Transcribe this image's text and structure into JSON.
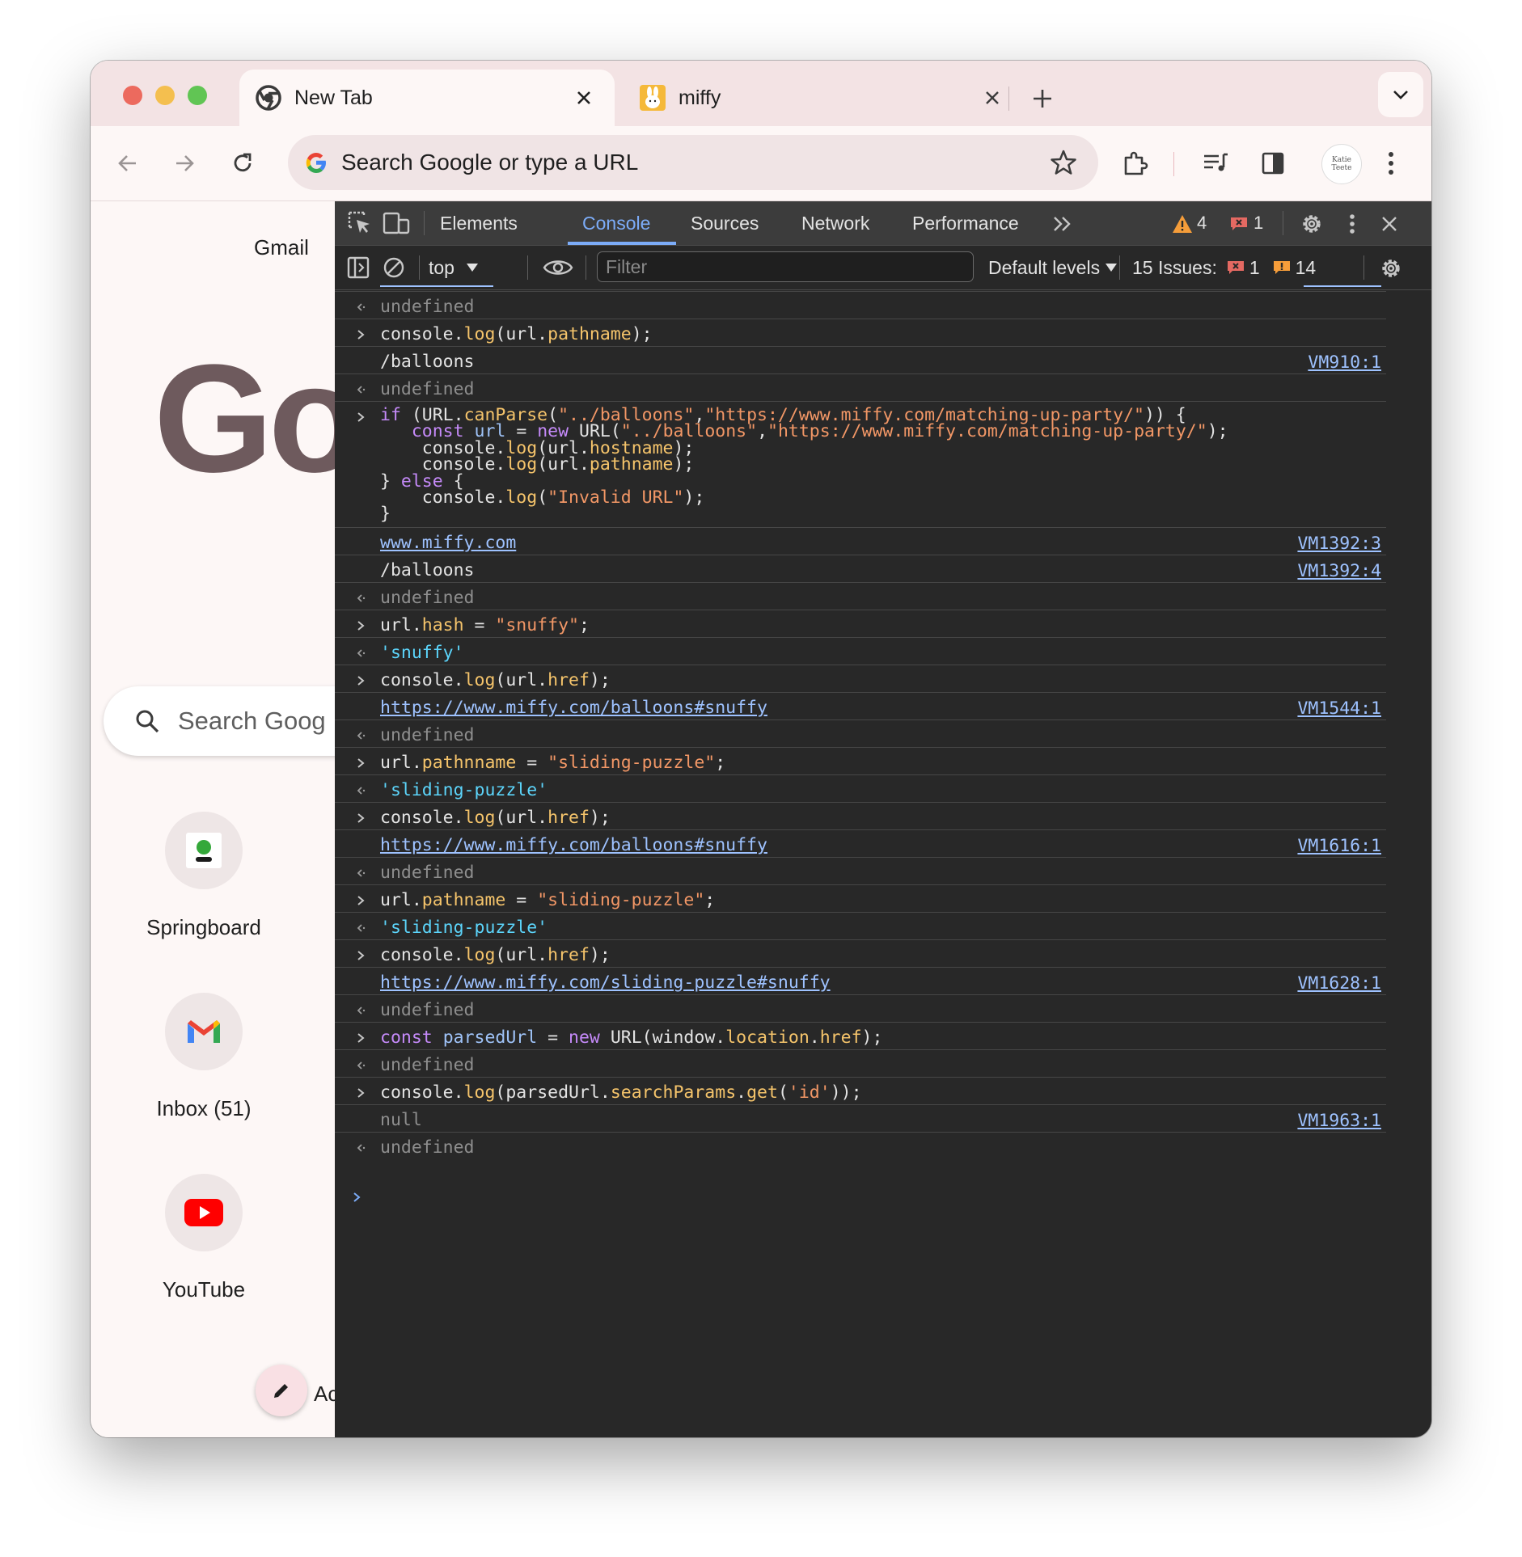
{
  "tabs": [
    {
      "title": "New Tab",
      "active": true,
      "icon": "chrome-icon"
    },
    {
      "title": "miffy",
      "active": false,
      "icon": "miffy-favicon"
    }
  ],
  "omnibox": {
    "placeholder": "Search Google or type a URL"
  },
  "profile": {
    "name": "Katie Teete"
  },
  "ntp": {
    "gmail": "Gmail",
    "logo": "Go",
    "search_placeholder": "Search Goog",
    "shortcuts": [
      {
        "label": "Springboard",
        "icon": "springboard-icon"
      },
      {
        "label": "Inbox (51)",
        "icon": "gmail-icon"
      },
      {
        "label": "YouTube",
        "icon": "youtube-icon"
      }
    ],
    "add_label": "Ac"
  },
  "devtools": {
    "tabs": [
      "Elements",
      "Console",
      "Sources",
      "Network",
      "Performance"
    ],
    "active_tab": "Console",
    "warnings": "4",
    "errors": "1",
    "context": "top",
    "filter_placeholder": "Filter",
    "levels": "Default levels",
    "issues_label": "15 Issues:",
    "issues_errors": "1",
    "issues_warnings": "14"
  },
  "console": {
    "undefined": "undefined",
    "r2_pathname": "pathname",
    "r3_out": "/balloons",
    "r3_src": "VM910:1",
    "c_canParse": "canParse",
    "c_rel": "\"../balloons\"",
    "c_base": "\"https://www.miffy.com/matching-up-party/\"",
    "c_hostname": "hostname",
    "c_invalid": "\"Invalid URL\"",
    "r6_out": "www.miffy.com",
    "r6_src": "VM1392:3",
    "r7_out": "/balloons",
    "r7_src": "VM1392:4",
    "r9_prop": "hash",
    "r9_val": "\"snuffy\"",
    "r10_out": "'snuffy'",
    "c_href": "href",
    "r12_out": "https://www.miffy.com/balloons#snuffy",
    "r12_src": "VM1544:1",
    "r14_prop": "pathnname",
    "r14_val": "\"sliding-puzzle\"",
    "r15_out": "'sliding-puzzle'",
    "r17_out": "https://www.miffy.com/balloons#snuffy",
    "r17_src": "VM1616:1",
    "r19_prop": "pathname",
    "r19_val": "\"sliding-puzzle\"",
    "r20_out": "'sliding-puzzle'",
    "r22_out": "https://www.miffy.com/sliding-puzzle#snuffy",
    "r22_src": "VM1628:1",
    "r24_var": "parsedUrl",
    "r24_location": "location",
    "r26_searchParams": "searchParams",
    "r26_get": "get",
    "r26_arg": "'id'",
    "r27_out": "null",
    "r27_src": "VM1963:1"
  },
  "colors": {
    "accent": "#7cacf8",
    "devtools_bg": "#282828",
    "tab_strip": "#f3e3e4",
    "warning": "#f59d3a",
    "error": "#e46962"
  }
}
